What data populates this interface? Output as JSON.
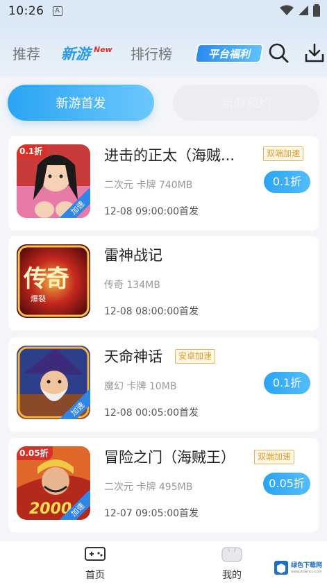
{
  "status_bar": {
    "time": "10:26",
    "indicator": "A"
  },
  "top_nav": {
    "tabs": [
      {
        "label": "推荐"
      },
      {
        "label": "新游"
      },
      {
        "label": "排行榜"
      }
    ],
    "new_badge": "New",
    "welfare_label": "平台福利",
    "icons": [
      "search-icon",
      "download-icon"
    ]
  },
  "filter_pills": {
    "left": "新游首发",
    "right": "新游预约"
  },
  "games": [
    {
      "title": "进击的正太（海贼...",
      "badge": "双端加速",
      "tags": "二次元 卡牌 740MB",
      "date": "12-08 09:00:00首发",
      "discount": "0.1折",
      "icon_discount": "0.1折",
      "icon_accel": "加速"
    },
    {
      "title": "雷神战记",
      "tags": "传奇 134MB",
      "date": "12-08 08:00:00首发",
      "icon_text_main": "传奇",
      "icon_text_sub": "爆裂"
    },
    {
      "title": "天命神话",
      "badge": "安卓加速",
      "tags": "魔幻 卡牌 10MB",
      "date": "12-08 00:05:00首发",
      "discount": "0.1折",
      "icon_accel": "加速"
    },
    {
      "title": "冒险之门（海贼王）",
      "badge": "双端加速",
      "tags": "二次元 卡牌 495MB",
      "date": "12-07 09:05:00首发",
      "discount": "0.05折",
      "icon_discount": "0.05折",
      "icon_accel": "加速",
      "icon_text_main": "2000"
    }
  ],
  "bottom_nav": {
    "home": "首页",
    "mine": "我的"
  },
  "colors": {
    "accent": "#2a9af0",
    "badge": "#e09a2b",
    "background": "#f3f5f8"
  }
}
